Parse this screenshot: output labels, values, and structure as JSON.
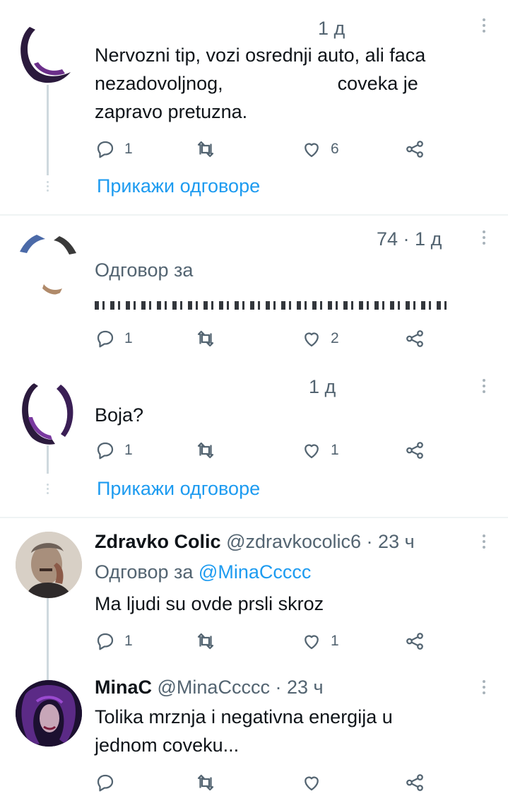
{
  "tweets": [
    {
      "time": "1 д",
      "text": "Nervozni tip, vozi osrednji auto, ali faca nezadovoljnog, coveka je zapravo pretuzna.",
      "text_lines": [
        "Nervozni tip, vozi osrednji auto, ali faca",
        "nezadovoljnog,",
        "coveka je",
        "zapravo pretuzna."
      ],
      "replies": "1",
      "retweets": "",
      "likes": "6",
      "show_replies": "Прикажи одговоре"
    },
    {
      "handle_tail": "74",
      "time": "1 д",
      "reply_prefix": "Одговор за",
      "replies": "1",
      "retweets": "",
      "likes": "2"
    },
    {
      "time": "1 д",
      "text": "Boja?",
      "replies": "1",
      "retweets": "",
      "likes": "1",
      "show_replies": "Прикажи одговоре"
    },
    {
      "name": "Zdravko Colic",
      "handle": "@zdravkocolic6",
      "time": "23 ч",
      "reply_prefix": "Одговор за",
      "reply_handle": "@MinaCcccc",
      "text": "Ma ljudi su ovde prsli skroz",
      "replies": "1",
      "retweets": "",
      "likes": "1"
    },
    {
      "name": "MinaC",
      "handle": "@MinaCcccc",
      "time": "23 ч",
      "text_lines": [
        "Tolika mrznja i negativna energija u",
        "jednom coveku..."
      ],
      "replies": "",
      "retweets": "",
      "likes": ""
    }
  ],
  "colors": {
    "accent": "#1d9bf0",
    "secondary_text": "#536471",
    "thread_line": "#cfd9de",
    "divider": "#eff3f4"
  },
  "icons": [
    "reply-icon",
    "retweet-icon",
    "like-icon",
    "share-icon",
    "more-icon"
  ]
}
